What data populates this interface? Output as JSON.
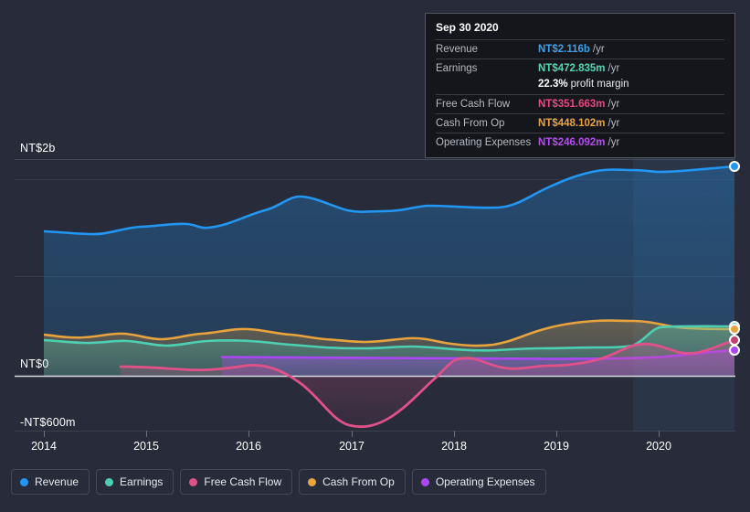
{
  "tooltip": {
    "date": "Sep 30 2020",
    "rows": [
      {
        "key": "Revenue",
        "value": "NT$2.116b",
        "unit": "/yr",
        "color": "#3aa0ea"
      },
      {
        "key": "Earnings",
        "value": "NT$472.835m",
        "unit": "/yr",
        "color": "#4fd8b6"
      },
      {
        "key": "",
        "value": "22.3%",
        "unit": "profit margin",
        "color": "#ffffff",
        "sub": true
      },
      {
        "key": "Free Cash Flow",
        "value": "NT$351.663m",
        "unit": "/yr",
        "color": "#e8477f"
      },
      {
        "key": "Cash From Op",
        "value": "NT$448.102m",
        "unit": "/yr",
        "color": "#e8a33d"
      },
      {
        "key": "Operating Expenses",
        "value": "NT$246.092m",
        "unit": "/yr",
        "color": "#b44cf0"
      }
    ]
  },
  "axes": {
    "y_labels": [
      "NT$2b",
      "NT$0",
      "-NT$600m"
    ],
    "x_labels": [
      "2014",
      "2015",
      "2016",
      "2017",
      "2018",
      "2019",
      "2020"
    ]
  },
  "legend": [
    {
      "label": "Revenue",
      "color": "#2196f3"
    },
    {
      "label": "Earnings",
      "color": "#4dd0b1"
    },
    {
      "label": "Free Cash Flow",
      "color": "#e0518a"
    },
    {
      "label": "Cash From Op",
      "color": "#e8a33d"
    },
    {
      "label": "Operating Expenses",
      "color": "#ab47f5"
    }
  ],
  "chart_data": {
    "type": "area",
    "title": "",
    "xlabel": "",
    "ylabel": "",
    "currency": "NT$",
    "ylim": [
      -600000000,
      2000000000
    ],
    "y_ticks": [
      2000000000,
      1000000000,
      0,
      -600000000
    ],
    "y_tick_labels": [
      "NT$2b",
      "",
      "NT$0",
      "-NT$600m"
    ],
    "x_ticks": [
      "2014",
      "2015",
      "2016",
      "2017",
      "2018",
      "2019",
      "2020"
    ],
    "grid": true,
    "legend_position": "bottom",
    "highlight_region": {
      "from": "2019.9",
      "to": "2020.75",
      "note": "selected period band"
    },
    "selected_point": {
      "date": "Sep 30 2020",
      "x": 804
    },
    "series": [
      {
        "name": "Revenue",
        "color": "#2196f3",
        "unit": "NT$",
        "x": [
          2014.0,
          2014.4,
          2014.8,
          2015.0,
          2015.3,
          2015.7,
          2016.0,
          2016.3,
          2016.6,
          2016.9,
          2017.2,
          2017.5,
          2017.8,
          2018.1,
          2018.4,
          2018.7,
          2019.0,
          2019.3,
          2019.6,
          2019.9,
          2020.2,
          2020.5,
          2020.75
        ],
        "values": [
          1270,
          1255,
          1290,
          1305,
          1315,
          1290,
          1330,
          1405,
          1460,
          1425,
          1400,
          1400,
          1420,
          1415,
          1425,
          1455,
          1540,
          1640,
          1745,
          1760,
          1750,
          1790,
          2116
        ],
        "values_unit": "millions",
        "end_value": "NT$2.116b"
      },
      {
        "name": "Earnings",
        "color": "#4dd0b1",
        "unit": "NT$",
        "x": [
          2014.0,
          2014.4,
          2014.8,
          2015.2,
          2015.6,
          2016.0,
          2016.4,
          2016.8,
          2017.2,
          2017.6,
          2018.0,
          2018.4,
          2018.8,
          2019.2,
          2019.6,
          2019.9,
          2020.2,
          2020.5,
          2020.75
        ],
        "values": [
          212,
          205,
          196,
          218,
          212,
          205,
          230,
          238,
          225,
          218,
          210,
          222,
          218,
          205,
          200,
          218,
          330,
          430,
          472.835
        ],
        "values_unit": "millions",
        "end_value": "NT$472.835m"
      },
      {
        "name": "Free Cash Flow",
        "color": "#e0518a",
        "unit": "NT$",
        "x": [
          2014.75,
          2015.2,
          2015.6,
          2016.0,
          2016.3,
          2016.6,
          2017.0,
          2017.4,
          2017.8,
          2018.1,
          2018.4,
          2018.7,
          2019.0,
          2019.3,
          2019.6,
          2019.9,
          2020.2,
          2020.5,
          2020.75
        ],
        "values": [
          -70,
          -75,
          -90,
          -130,
          40,
          -90,
          -560,
          -480,
          -230,
          110,
          40,
          -5,
          -90,
          -55,
          60,
          135,
          185,
          95,
          351.663
        ],
        "values_unit": "millions",
        "end_value": "NT$351.663m"
      },
      {
        "name": "Cash From Op",
        "color": "#e8a33d",
        "unit": "NT$",
        "x": [
          2014.0,
          2014.4,
          2014.8,
          2015.2,
          2015.6,
          2016.0,
          2016.4,
          2016.8,
          2017.2,
          2017.6,
          2018.0,
          2018.4,
          2018.8,
          2019.2,
          2019.6,
          2019.9,
          2020.2,
          2020.5,
          2020.75
        ],
        "values": [
          248,
          238,
          256,
          252,
          236,
          268,
          276,
          246,
          238,
          230,
          236,
          252,
          300,
          340,
          380,
          395,
          370,
          365,
          448.102
        ],
        "values_unit": "millions",
        "end_value": "NT$448.102m"
      },
      {
        "name": "Operating Expenses",
        "color": "#ab47f5",
        "unit": "NT$",
        "x": [
          2015.75,
          2016.2,
          2016.7,
          2017.2,
          2017.7,
          2018.2,
          2018.7,
          2019.2,
          2019.7,
          2020.2,
          2020.5,
          2020.75
        ],
        "values": [
          122,
          120,
          118,
          116,
          115,
          116,
          118,
          120,
          122,
          128,
          160,
          246.092
        ],
        "values_unit": "millions",
        "end_value": "NT$246.092m"
      }
    ]
  }
}
